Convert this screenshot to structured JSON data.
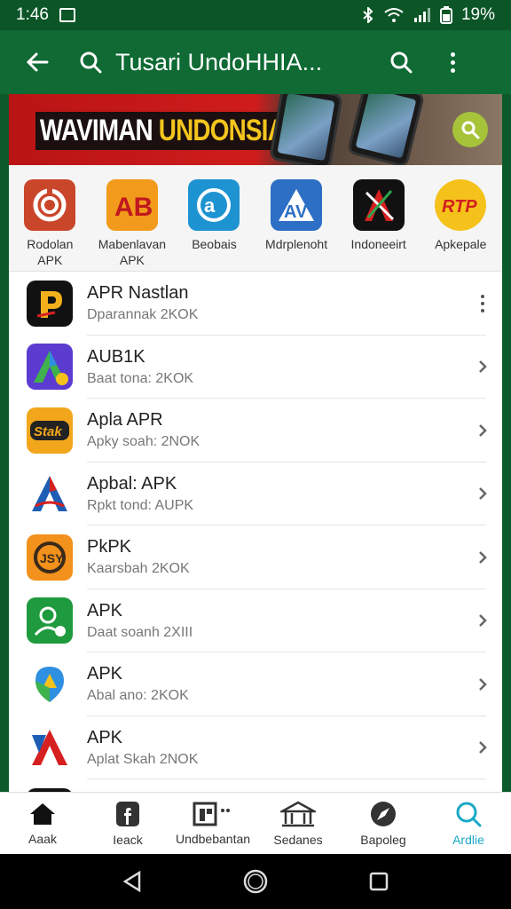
{
  "status_bar": {
    "time": "1:46"
  },
  "app_bar": {
    "title": "Tusari UndoHHIA...",
    "brand_color": "#0f6a34"
  },
  "banner": {
    "text_white": "WAVIMAN ",
    "text_yellow": "UNDONSIA"
  },
  "categories": [
    {
      "label": "Rodolan\nAPK",
      "icon": "circle-logo-icon"
    },
    {
      "label": "Mabenlavan\nAPK",
      "icon": "ab-logo-icon"
    },
    {
      "label": "Beobais",
      "icon": "at-logo-icon"
    },
    {
      "label": "Mdrplenoht",
      "icon": "av-logo-icon"
    },
    {
      "label": "Indoneeirt",
      "icon": "a-logo-icon"
    },
    {
      "label": "Apkepale",
      "icon": "rtp-logo-icon"
    }
  ],
  "apps": [
    {
      "title": "APR Nastlan",
      "subtitle": "Dparannak 2KOK",
      "trailing": "more"
    },
    {
      "title": "AUB1K",
      "subtitle": "Baat tona: 2KOK",
      "trailing": "chevron"
    },
    {
      "title": "Apla APR",
      "subtitle": "Apky soah: 2NOK",
      "trailing": "chevron"
    },
    {
      "title": "Apbal: APK",
      "subtitle": "Rpkt tond: AUPK",
      "trailing": "chevron"
    },
    {
      "title": "PkPK",
      "subtitle": "Kaarsbah 2KOK",
      "trailing": "chevron"
    },
    {
      "title": "APK",
      "subtitle": "Daat soanh 2XIII",
      "trailing": "chevron"
    },
    {
      "title": "APK",
      "subtitle": "Abal ano: 2KOK",
      "trailing": "chevron"
    },
    {
      "title": "APK",
      "subtitle": "Aplat Skah 2NOK",
      "trailing": "chevron"
    }
  ],
  "bottom_nav": [
    {
      "label": "Aaak",
      "icon": "home-icon",
      "active": false
    },
    {
      "label": "Ieack",
      "icon": "facebook-icon",
      "active": false
    },
    {
      "label": "Undbebantan",
      "icon": "widget-icon",
      "active": false
    },
    {
      "label": "Sedanes",
      "icon": "temple-icon",
      "active": false
    },
    {
      "label": "Bapoleg",
      "icon": "compass-icon",
      "active": false
    },
    {
      "label": "Ardlie",
      "icon": "search-icon",
      "active": true
    }
  ]
}
